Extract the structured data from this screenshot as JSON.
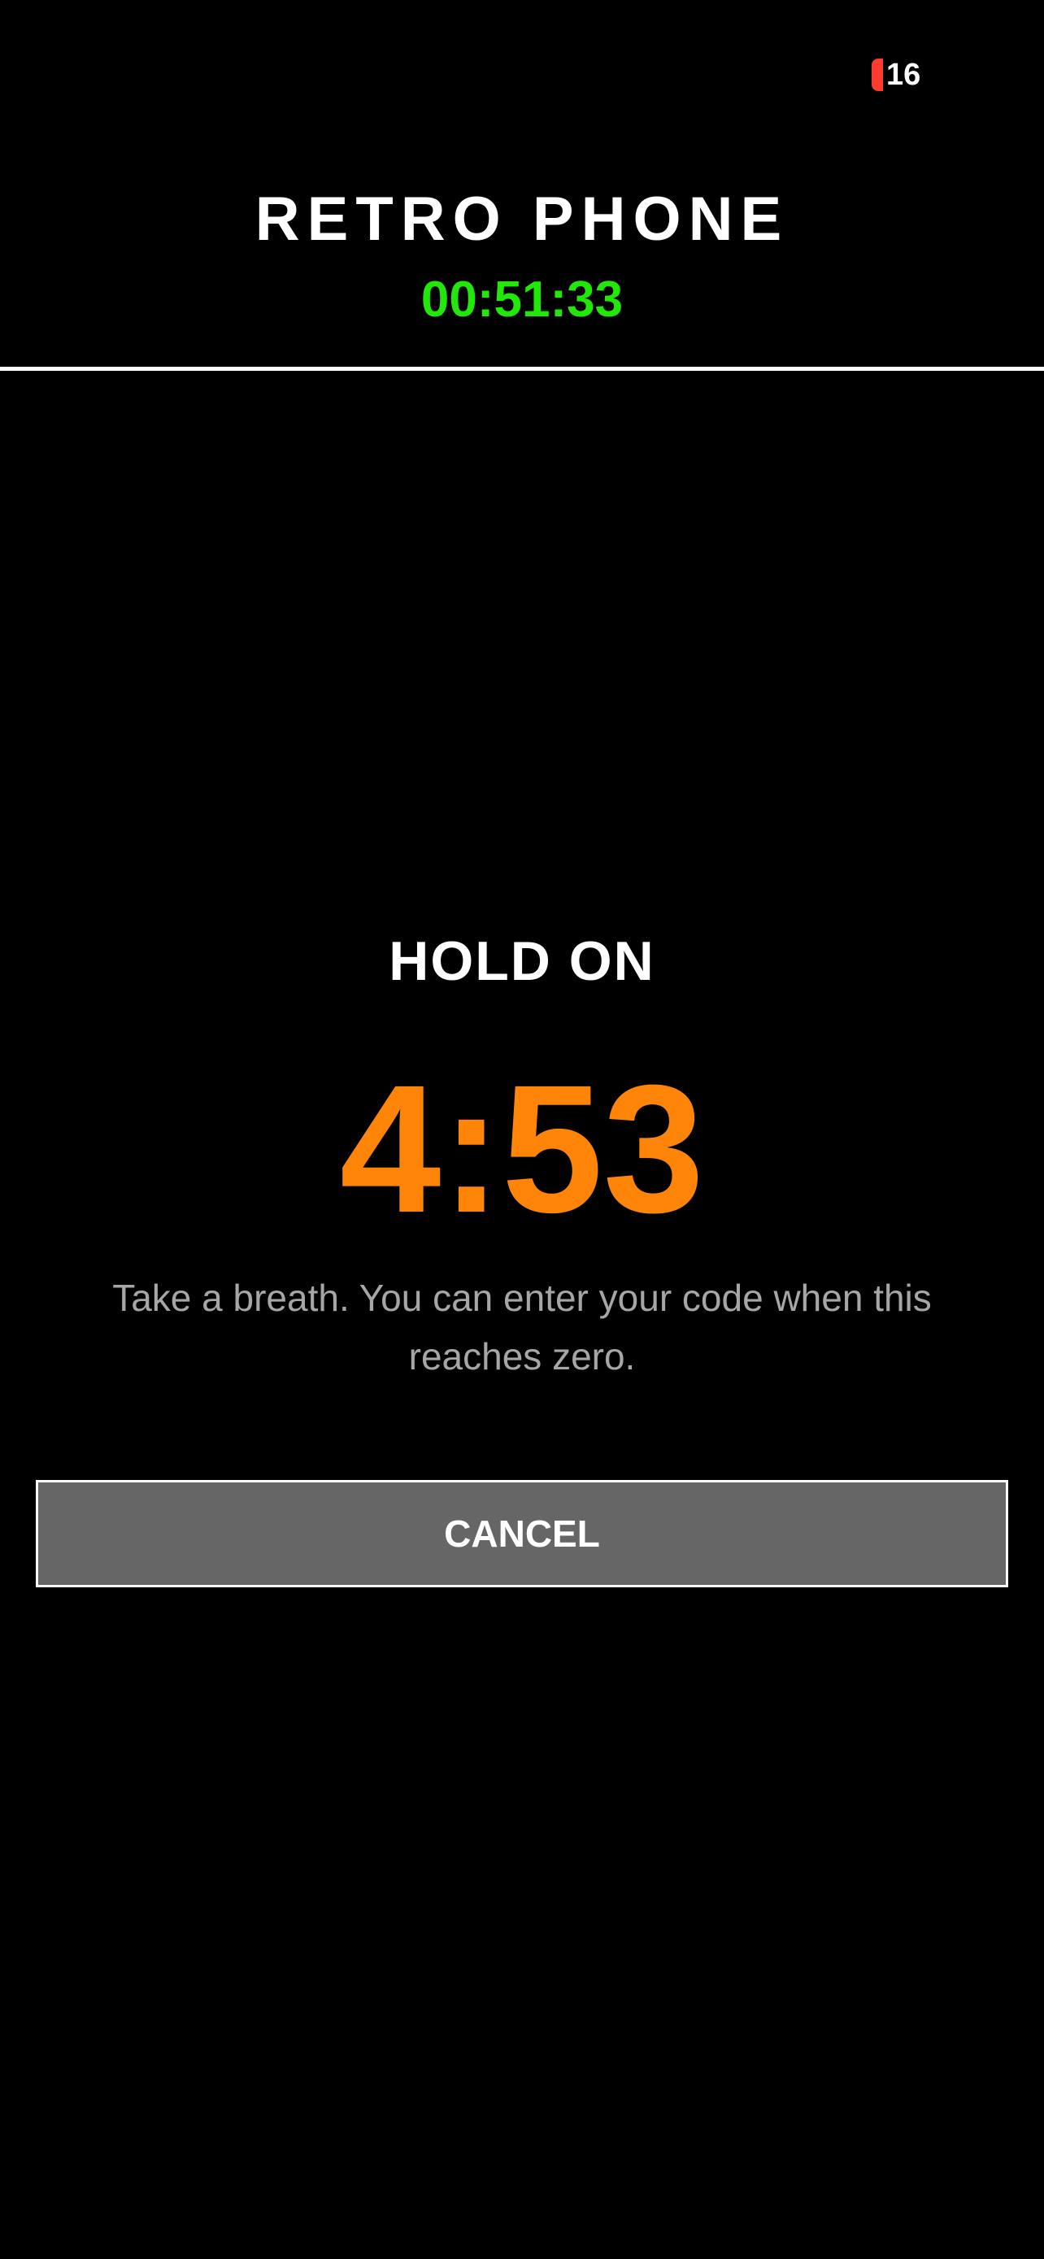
{
  "status_bar": {
    "battery_level": "16",
    "battery_color": "#ff3b30"
  },
  "header": {
    "title": "RETRO PHONE",
    "session_timer": "00:51:33",
    "timer_color": "#22e80a"
  },
  "hold_screen": {
    "heading": "HOLD ON",
    "countdown": "4:53",
    "countdown_color": "#ff8508",
    "message": "Take a breath. You can enter your code when this reaches zero.",
    "message_color": "#a6a6a6"
  },
  "cancel": {
    "label": "CANCEL",
    "background": "#666666"
  }
}
